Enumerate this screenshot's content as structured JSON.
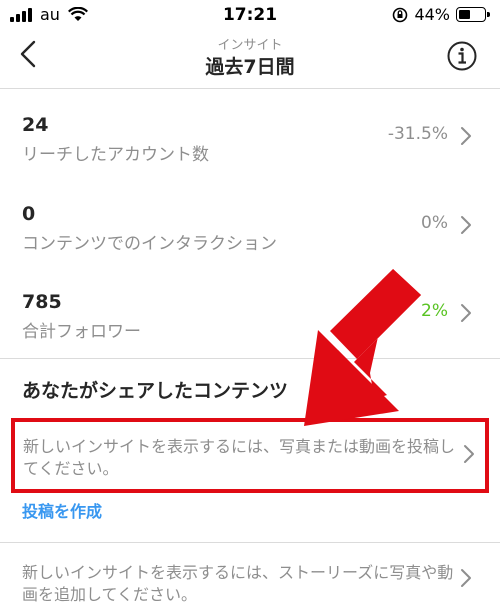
{
  "status_bar": {
    "carrier": "au",
    "time": "17:21",
    "battery": "44%"
  },
  "header": {
    "subtitle": "インサイト",
    "title": "過去7日間"
  },
  "metrics": [
    {
      "value": "24",
      "label": "リーチしたアカウント数",
      "change": "-31.5%"
    },
    {
      "value": "0",
      "label": "コンテンツでのインタラクション",
      "change": "0%"
    },
    {
      "value": "785",
      "label": "合計フォロワー",
      "change": "2%"
    }
  ],
  "shared_content": {
    "title": "あなたがシェアしたコンテンツ",
    "posts_message": "新しいインサイトを表示するには、写真または動画を投稿してください。",
    "create_post": "投稿を作成",
    "stories_message": "新しいインサイトを表示するには、ストーリーズに写真や動画を追加してください。"
  },
  "colors": {
    "accent": "#3897f0",
    "positive": "#58c322",
    "highlight": "#e00b14"
  }
}
